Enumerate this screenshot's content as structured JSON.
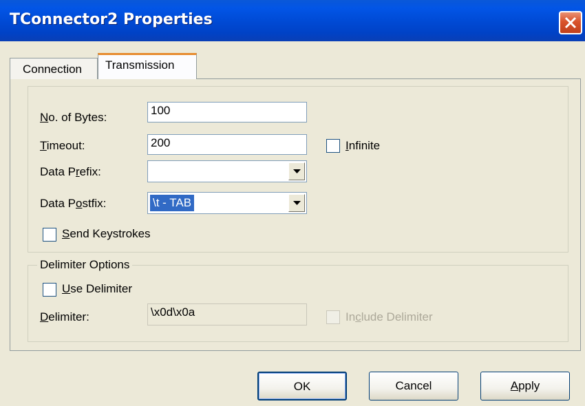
{
  "window": {
    "title": "TConnector2 Properties",
    "close_icon": "close-icon"
  },
  "tabs": [
    {
      "label": "Connection",
      "active": false
    },
    {
      "label": "Transmission",
      "active": true
    }
  ],
  "fields": {
    "bytes": {
      "label_pre": "",
      "label_key": "N",
      "label_post": "o. of Bytes:",
      "value": "100"
    },
    "timeout": {
      "label_pre": "",
      "label_key": "T",
      "label_post": "imeout:",
      "value": "200"
    },
    "infinite": {
      "label_pre": "",
      "label_key": "I",
      "label_post": "nfinite",
      "checked": false
    },
    "prefix": {
      "label_pre": "Data P",
      "label_key": "r",
      "label_post": "efix:",
      "value": ""
    },
    "postfix": {
      "label_pre": "Data P",
      "label_key": "o",
      "label_post": "stfix:",
      "value": "\\t - TAB"
    },
    "send_keystrokes": {
      "label_pre": "",
      "label_key": "S",
      "label_post": "end Keystrokes",
      "checked": false
    }
  },
  "delimiter_group": {
    "title": "Delimiter Options",
    "use_delimiter": {
      "label_pre": "",
      "label_key": "U",
      "label_post": "se Delimiter",
      "checked": false
    },
    "delimiter": {
      "label_pre": "",
      "label_key": "D",
      "label_post": "elimiter:",
      "value": "\\x0d\\x0a"
    },
    "include_delimiter": {
      "label_pre": "In",
      "label_key": "c",
      "label_post": "lude Delimiter",
      "checked": false,
      "enabled": false
    }
  },
  "buttons": {
    "ok": "OK",
    "cancel": "Cancel",
    "apply_key": "A",
    "apply_post": "pply"
  }
}
